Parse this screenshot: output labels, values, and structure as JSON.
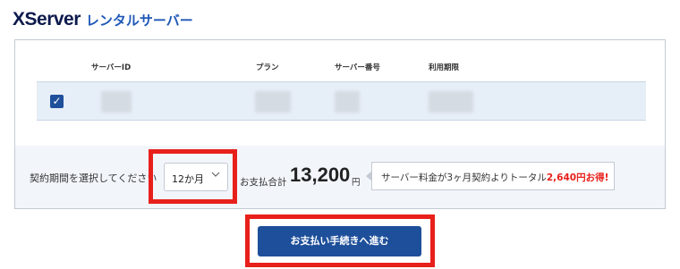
{
  "brand": {
    "name": "XServer",
    "sub": "レンタルサーバー"
  },
  "table": {
    "headers": [
      "サーバーID",
      "プラン",
      "サーバー番号",
      "利用期限"
    ],
    "row": {
      "checked": true
    }
  },
  "footer": {
    "period_label": "契約期間を選択してください",
    "period_value": "12か月",
    "total_label": "お支払合計",
    "total_amount": "13,200",
    "total_unit": "円",
    "callout_text": "サーバー料金が3ヶ月契約よりトータル",
    "callout_highlight": "2,640円お得!"
  },
  "cta": {
    "label": "お支払い手続きへ進む"
  },
  "colors": {
    "accent": "#1e4f9a",
    "highlight_red": "#e8201b",
    "brand_dark": "#0d1a4c"
  }
}
